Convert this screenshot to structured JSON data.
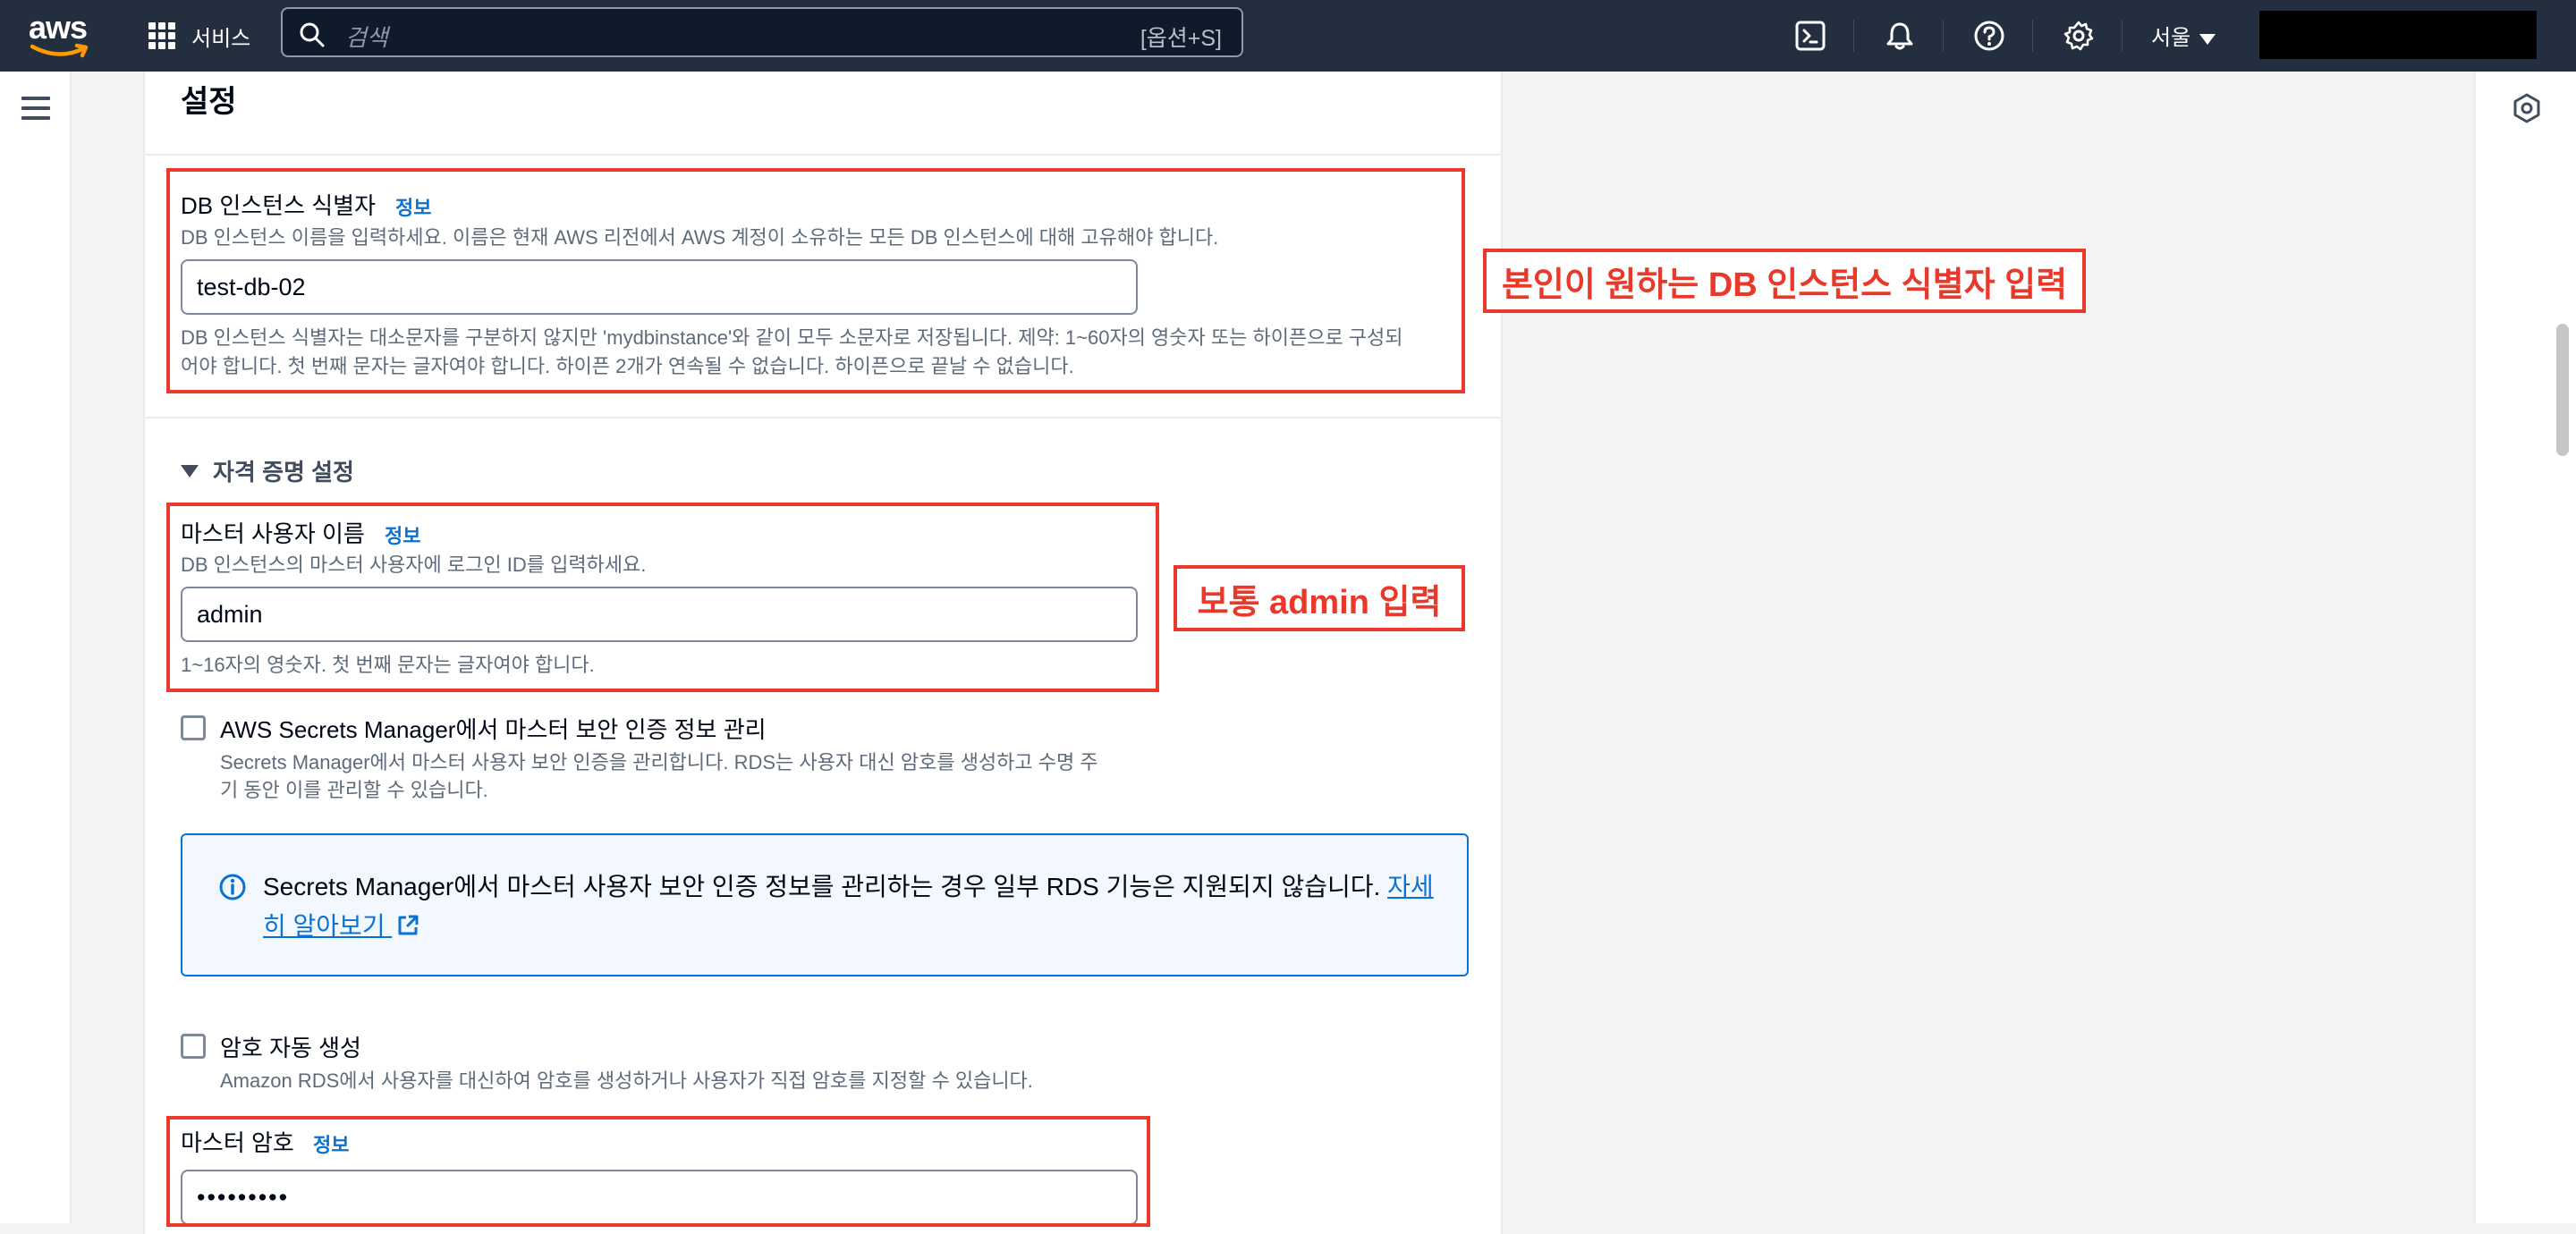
{
  "topnav": {
    "logo_text": "aws",
    "services_label": "서비스",
    "search_placeholder": "검색",
    "search_shortcut": "[옵션+S]",
    "region_label": "서울"
  },
  "panel": {
    "title": "설정",
    "db_identifier": {
      "label": "DB 인스턴스 식별자",
      "info": "정보",
      "description": "DB 인스턴스 이름을 입력하세요. 이름은 현재 AWS 리전에서 AWS 계정이 소유하는 모든 DB 인스턴스에 대해 고유해야 합니다.",
      "value": "test-db-02",
      "constraint_line1": "DB 인스턴스 식별자는 대소문자를 구분하지 않지만 'mydbinstance'와 같이 모두 소문자로 저장됩니다. 제약: 1~60자의 영숫자 또는 하이픈으로 구성되",
      "constraint_line2": "어야 합니다. 첫 번째 문자는 글자여야 합니다. 하이픈 2개가 연속될 수 없습니다. 하이픈으로 끝날 수 없습니다."
    },
    "credentials_section": "자격 증명 설정",
    "master_username": {
      "label": "마스터 사용자 이름",
      "info": "정보",
      "description": "DB 인스턴스의 마스터 사용자에 로그인 ID를 입력하세요.",
      "value": "admin",
      "constraint": "1~16자의 영숫자. 첫 번째 문자는 글자여야 합니다."
    },
    "secrets_manager": {
      "label": "AWS Secrets Manager에서 마스터 보안 인증 정보 관리",
      "description_line1": "Secrets Manager에서 마스터 사용자 보안 인증을 관리합니다. RDS는 사용자 대신 암호를 생성하고 수명 주",
      "description_line2": "기 동안 이를 관리할 수 있습니다.",
      "checked": false
    },
    "alert": {
      "text": "Secrets Manager에서 마스터 사용자 보안 인증 정보를 관리하는 경우 일부 RDS 기능은 지원되지 않습니다.",
      "link": "자세히 알아보기"
    },
    "auto_password": {
      "label": "암호 자동 생성",
      "description": "Amazon RDS에서 사용자를 대신하여 암호를 생성하거나 사용자가 직접 암호를 지정할 수 있습니다.",
      "checked": false
    },
    "master_password": {
      "label": "마스터 암호",
      "info": "정보",
      "value": "•••••••••"
    }
  },
  "annotations": {
    "db_identifier_note": "본인이 원하는 DB 인스턴스 식별자 입력",
    "username_note": "보통 admin 입력"
  },
  "colors": {
    "nav_bg": "#232f3e",
    "link_blue": "#0972d3",
    "annotation_red": "#e8392a",
    "alert_bg": "#f2f8fd"
  }
}
